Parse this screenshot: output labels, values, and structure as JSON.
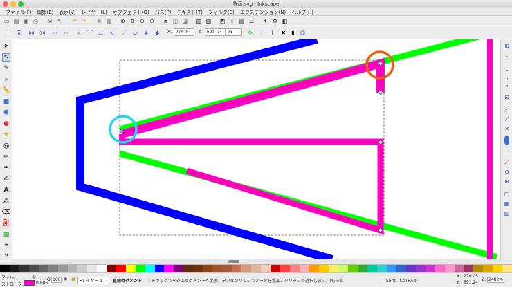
{
  "window": {
    "title": "描画.svg - Inkscape"
  },
  "menu": [
    "ファイル(F)",
    "編集(E)",
    "表示(V)",
    "レイヤー(L)",
    "オブジェクト(O)",
    "パス(P)",
    "テキスト(T)",
    "フィルタ(S)",
    "エクステンション(N)",
    "ヘルプ(H)"
  ],
  "nodebar": {
    "x_label": "X:",
    "x_value": "270.03",
    "y_label": "Y:",
    "y_value": "691.23",
    "unit": "px"
  },
  "status": {
    "fill_label": "フィル:",
    "fill_value": "なし",
    "stroke_label": "ストローク:",
    "stroke_width": "0.886",
    "opacity_label": "O:",
    "opacity_value": "100",
    "layer": "•レイヤー 1",
    "message_bold": "直線セグメント",
    "message": ": ドラッグでベジエセグメントへ変換、ダブルクリックでノードを追加、クリックで選択します。(もっと",
    "shortcut": "Shift、Ctrl+Alt)",
    "x_label": "X:",
    "x_value": "270.03",
    "y_label": "Y:",
    "y_value": "691.24",
    "zoom_label": "Z:",
    "zoom_value": "2482%"
  },
  "colors": {
    "blue": "#0000ff",
    "green": "#00ff00",
    "magenta": "#ff00cc",
    "circle_cyan": "#22d6ee",
    "circle_orange": "#f06010"
  },
  "palette": [
    "#000000",
    "#1a1a1a",
    "#333333",
    "#4d4d4d",
    "#666666",
    "#808080",
    "#999999",
    "#b3b3b3",
    "#cccccc",
    "#e6e6e6",
    "#ffffff",
    "#800000",
    "#ff0000",
    "#ffff00",
    "#00ff00",
    "#00ffff",
    "#0000ff",
    "#ff00ff",
    "#800080",
    "#5a2d0c",
    "#6b3410",
    "#8b4513",
    "#a0522d",
    "#a85a3c",
    "#c07050",
    "#d49a7a",
    "#e0b898",
    "#f0d0b8",
    "#c80000",
    "#ff4040",
    "#ff8080",
    "#ffb0b0",
    "#ff9900",
    "#ffcc00",
    "#ffee66",
    "#ccff66",
    "#66cc00",
    "#33aa33",
    "#00cc99",
    "#33cccc",
    "#3399ff",
    "#3366cc",
    "#6633cc",
    "#9933cc",
    "#cc33cc",
    "#ff66cc",
    "#ff99cc",
    "#cc6699",
    "#993366",
    "#b38f00",
    "#d9a600",
    "#ffd500",
    "#ffe680"
  ]
}
